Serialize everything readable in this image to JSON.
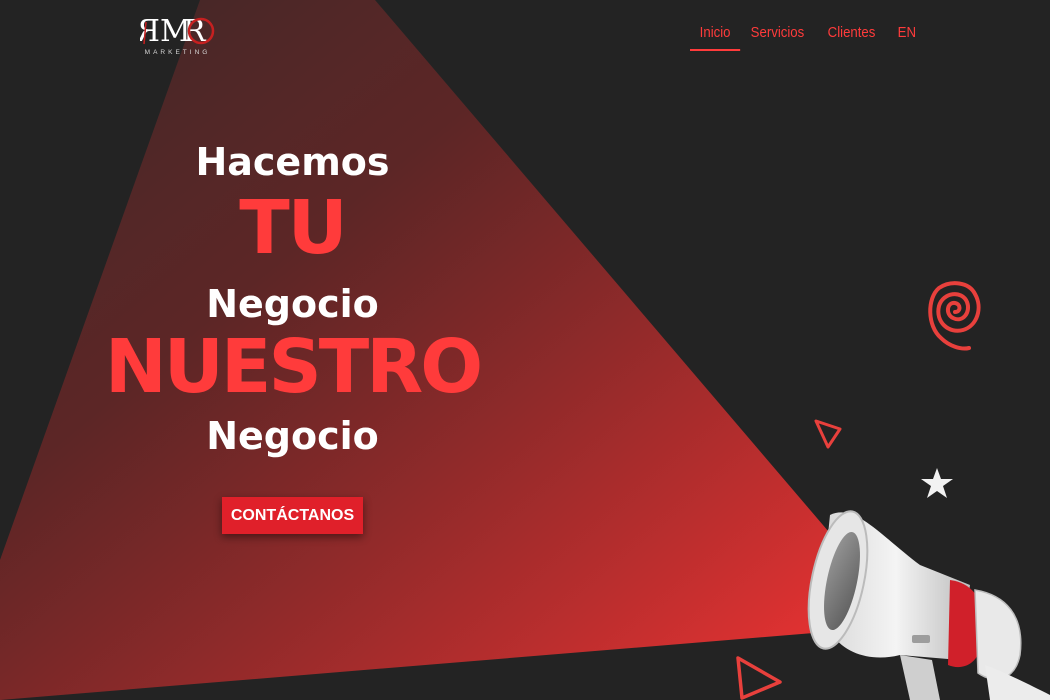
{
  "brand": {
    "logo_text": "RMRO",
    "logo_subtitle": "MARKETING"
  },
  "nav": {
    "items": [
      {
        "label": "Inicio",
        "active": true
      },
      {
        "label": "Servicios",
        "active": false
      },
      {
        "label": "Clientes",
        "active": false
      },
      {
        "label": "EN",
        "active": false
      }
    ]
  },
  "hero": {
    "line1": "Hacemos",
    "line2": "TU",
    "line3": "Negocio",
    "line4": "NUESTRO",
    "line5": "Negocio"
  },
  "cta": {
    "label": "CONTÁCTANOS"
  },
  "decorations": [
    "spiral-icon",
    "triangle-icon",
    "star-icon",
    "megaphone-image"
  ],
  "colors": {
    "background": "#232323",
    "accent": "#ff3b3b",
    "button": "#e0202a",
    "text": "#ffffff"
  }
}
